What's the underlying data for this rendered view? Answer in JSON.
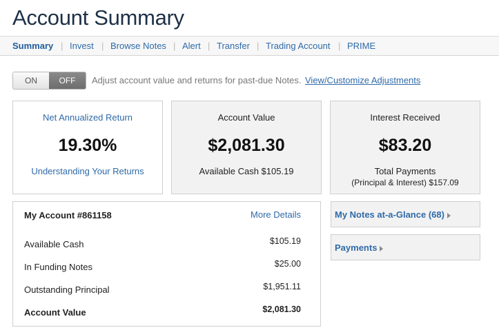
{
  "page_title": "Account Summary",
  "nav": {
    "items": [
      "Summary",
      "Invest",
      "Browse Notes",
      "Alert",
      "Transfer",
      "Trading Account",
      "PRIME"
    ],
    "separator": "|"
  },
  "adjustment": {
    "toggle_on": "ON",
    "toggle_off": "OFF",
    "description": "Adjust account value and returns for past-due Notes.",
    "link": "View/Customize Adjustments"
  },
  "cards": {
    "return": {
      "title": "Net Annualized Return",
      "value": "19.30%",
      "link": "Understanding Your Returns"
    },
    "account_value": {
      "title": "Account Value",
      "value": "$2,081.30",
      "sub": "Available Cash $105.19"
    },
    "interest": {
      "title": "Interest Received",
      "value": "$83.20",
      "sub1": "Total Payments",
      "sub2": "(Principal & Interest) $157.09"
    }
  },
  "my_account": {
    "title": "My Account #861158",
    "more": "More Details",
    "rows": [
      {
        "label": "Available Cash",
        "value": "$105.19"
      },
      {
        "label": "In Funding Notes",
        "value": "$25.00"
      },
      {
        "label": "Outstanding Principal",
        "value": "$1,951.11"
      },
      {
        "label": "Account Value",
        "value": "$2,081.30"
      }
    ]
  },
  "side_links": {
    "notes": "My Notes at-a-Glance (68)",
    "payments": "Payments"
  }
}
